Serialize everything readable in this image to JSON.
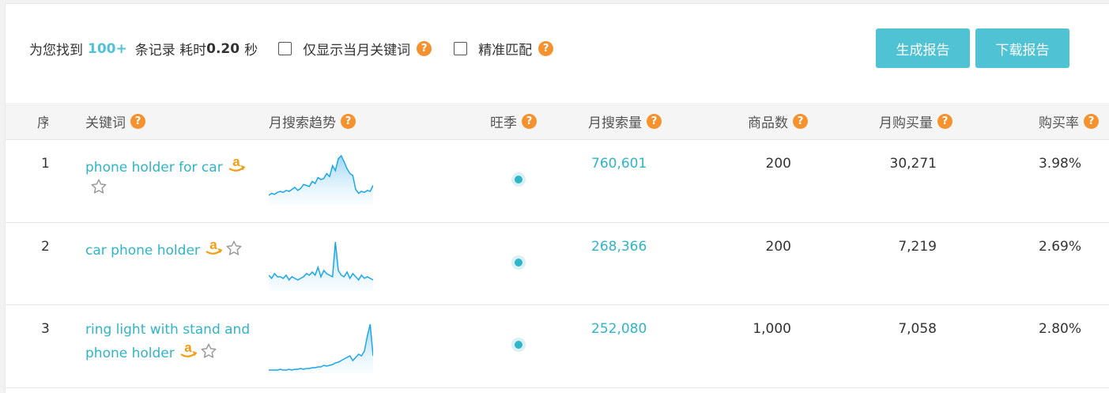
{
  "summary": {
    "prefix": "为您找到",
    "count": "100+",
    "middle": "条记录 耗时",
    "time": "0.20",
    "suffix": "秒",
    "opt_month_label": "仅显示当月关键词",
    "opt_exact_label": "精准匹配"
  },
  "buttons": {
    "generate": "生成报告",
    "download": "下载报告"
  },
  "help_glyph": "?",
  "columns": {
    "index": "序",
    "keyword": "关键词",
    "trend": "月搜索趋势",
    "season": "旺季",
    "monthly_search": "月搜索量",
    "products": "商品数",
    "monthly_purchase": "月购买量",
    "purchase_rate": "购买率"
  },
  "colors": {
    "accent": "#4fc3d4",
    "link": "#2fb4c8",
    "help": "#f5922f",
    "amazon": "#f39c12"
  },
  "icons": [
    "help-icon",
    "amazon-icon",
    "star-icon",
    "checkbox-icon",
    "peak-season-dot-icon"
  ],
  "rows": [
    {
      "index": "1",
      "keyword": "phone holder for car",
      "monthly_search": "760,601",
      "products": "200",
      "monthly_purchase": "30,271",
      "purchase_rate": "3.98%",
      "trend": [
        8,
        10,
        9,
        11,
        12,
        11,
        13,
        12,
        14,
        16,
        13,
        15,
        19,
        18,
        17,
        22,
        20,
        26,
        24,
        25,
        30,
        27,
        38,
        33,
        45,
        48,
        42,
        35,
        30,
        28,
        14,
        10,
        12,
        11,
        13,
        12,
        18
      ]
    },
    {
      "index": "2",
      "keyword": "car phone holder",
      "monthly_search": "268,366",
      "products": "200",
      "monthly_purchase": "7,219",
      "purchase_rate": "2.69%",
      "trend": [
        9,
        7,
        10,
        8,
        8,
        7,
        9,
        6,
        8,
        7,
        6,
        7,
        8,
        10,
        9,
        11,
        9,
        14,
        8,
        12,
        10,
        9,
        8,
        30,
        12,
        9,
        8,
        11,
        7,
        10,
        8,
        6,
        9,
        7,
        8,
        7,
        6
      ]
    },
    {
      "index": "3",
      "keyword": "ring light with stand and phone holder",
      "monthly_search": "252,080",
      "products": "1,000",
      "monthly_purchase": "7,058",
      "purchase_rate": "2.80%",
      "trend": [
        2,
        2,
        2,
        2,
        3,
        2,
        2,
        3,
        2,
        3,
        3,
        4,
        3,
        4,
        4,
        5,
        5,
        6,
        6,
        8,
        7,
        8,
        9,
        11,
        12,
        14,
        16,
        18,
        20,
        14,
        18,
        22,
        20,
        26,
        45,
        60,
        20
      ]
    }
  ]
}
